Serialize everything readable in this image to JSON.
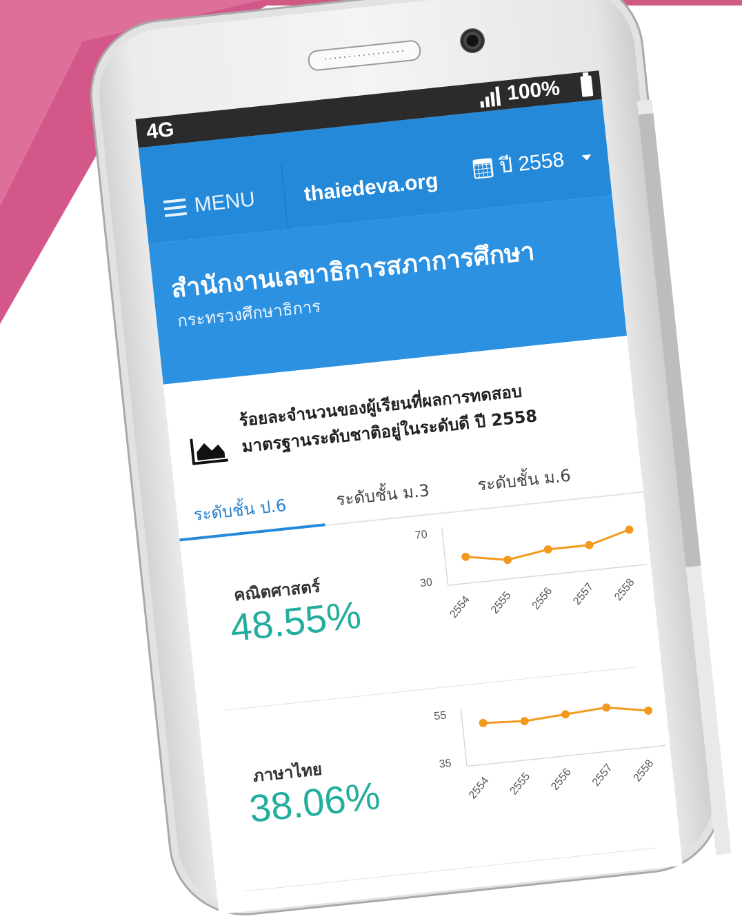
{
  "status": {
    "network": "4G",
    "battery": "100%"
  },
  "device": {
    "speaker_dots": "................."
  },
  "appbar": {
    "menu_label": "MENU",
    "site": "thaiedeva.org",
    "year_label": "ปี 2558"
  },
  "org": {
    "title": "สำนักงานเลขาธิการสภาการศึกษา",
    "subtitle": "กระทรวงศึกษาธิการ"
  },
  "card": {
    "icon": "area-chart-icon",
    "title_line1": "ร้อยละจำนวนของผู้เรียนที่ผลการทดสอบ",
    "title_line2": "มาตรฐานระดับชาติอยู่ในระดับดี ปี 2558"
  },
  "tabs": [
    {
      "label": "ระดับชั้น ป.6",
      "active": true
    },
    {
      "label": "ระดับชั้น ม.3",
      "active": false
    },
    {
      "label": "ระดับชั้น ม.6",
      "active": false
    }
  ],
  "subjects": [
    {
      "name": "คณิตศาสตร์",
      "value": "48.55%"
    },
    {
      "name": "ภาษาไทย",
      "value": "38.06%"
    }
  ],
  "colors": {
    "appbar": "#2389d8",
    "header": "#2b91e0",
    "accent_text": "#23ad9c",
    "line": "#f39a1e",
    "brand_pink": "#cf5a84"
  },
  "chart_data": [
    {
      "type": "line",
      "x": [
        "2554",
        "2555",
        "2556",
        "2557",
        "2558"
      ],
      "values": [
        48,
        42,
        47,
        47,
        56
      ],
      "ylim": [
        30,
        70
      ],
      "yticks": [
        "70",
        "30"
      ]
    },
    {
      "type": "line",
      "x": [
        "2554",
        "2555",
        "2556",
        "2557",
        "2558"
      ],
      "values": [
        50,
        49,
        50,
        51,
        48
      ],
      "ylim": [
        35,
        55
      ],
      "yticks": [
        "55",
        "35"
      ]
    }
  ]
}
